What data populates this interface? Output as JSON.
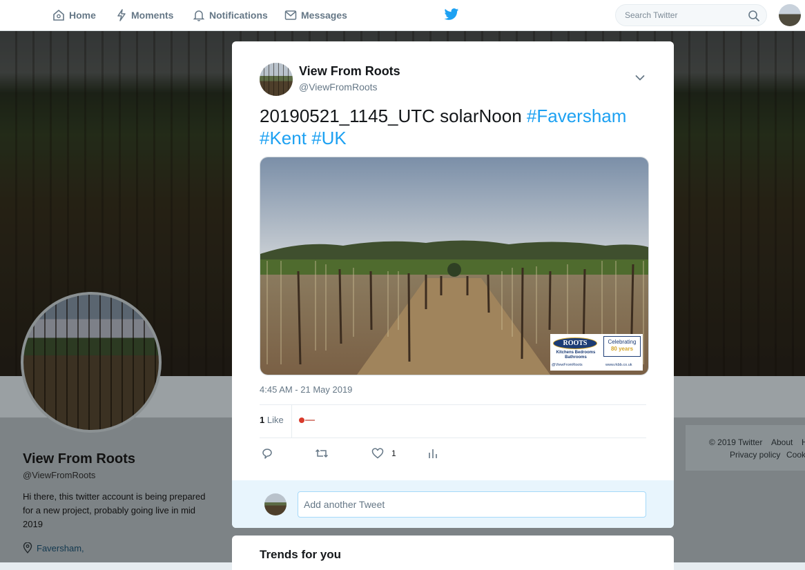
{
  "nav": {
    "home_label": "Home",
    "moments_label": "Moments",
    "notifications_label": "Notifications",
    "messages_label": "Messages",
    "search_placeholder": "Search Twitter",
    "brand_color": "#1da1f2"
  },
  "profile": {
    "name": "View From Roots",
    "handle": "@ViewFromRoots",
    "bio": "Hi there, this twitter account is being prepared for a new project, probably going live in mid 2019",
    "location": "Faversham,"
  },
  "footer": {
    "line1": [
      "© 2019 Twitter",
      "About",
      "H"
    ],
    "line2": [
      "Privacy policy",
      "Cook"
    ]
  },
  "tweet": {
    "author_name": "View From Roots",
    "author_handle": "@ViewFromRoots",
    "text_plain": "20190521_1145_UTC solarNoon ",
    "hashtags": [
      "#Faversham",
      "#Kent",
      "#UK"
    ],
    "timestamp": "4:45 AM - 21 May 2019",
    "like_count": "1",
    "like_label": "Like",
    "action_like_count": "1",
    "image_overlay": {
      "brand": "ROOTS",
      "subtitle": "Kitchens Bedrooms Bathrooms",
      "handle": "@ViewFromRoots",
      "badge_top": "Celebrating",
      "badge_main": "80 years",
      "website": "www.rkbb.co.uk"
    }
  },
  "reply": {
    "placeholder": "Add another Tweet"
  },
  "trends": {
    "title": "Trends for you"
  }
}
